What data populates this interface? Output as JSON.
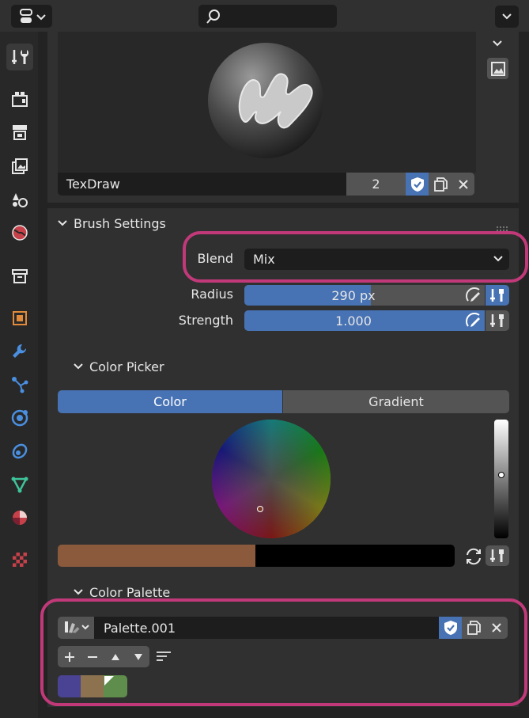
{
  "header": {
    "search_placeholder": ""
  },
  "brush": {
    "name": "TexDraw",
    "users": "2"
  },
  "brush_settings": {
    "title": "Brush Settings",
    "blend_label": "Blend",
    "blend_value": "Mix",
    "radius_label": "Radius",
    "radius_value": "290 px",
    "radius_fraction": 0.58,
    "strength_label": "Strength",
    "strength_value": "1.000",
    "strength_fraction": 1.0
  },
  "color_picker": {
    "title": "Color Picker",
    "tabs": [
      {
        "label": "Color",
        "active": true
      },
      {
        "label": "Gradient",
        "active": false
      }
    ],
    "primary_color": "#8b5a3c",
    "secondary_color": "#000000"
  },
  "color_palette": {
    "title": "Color Palette",
    "palette_name": "Palette.001",
    "swatches": [
      "#4a4393",
      "#8d7250",
      "#5e8d4c"
    ]
  },
  "colors": {
    "accent": "#4772b3",
    "highlight": "#c2397a",
    "panel": "#303030"
  }
}
